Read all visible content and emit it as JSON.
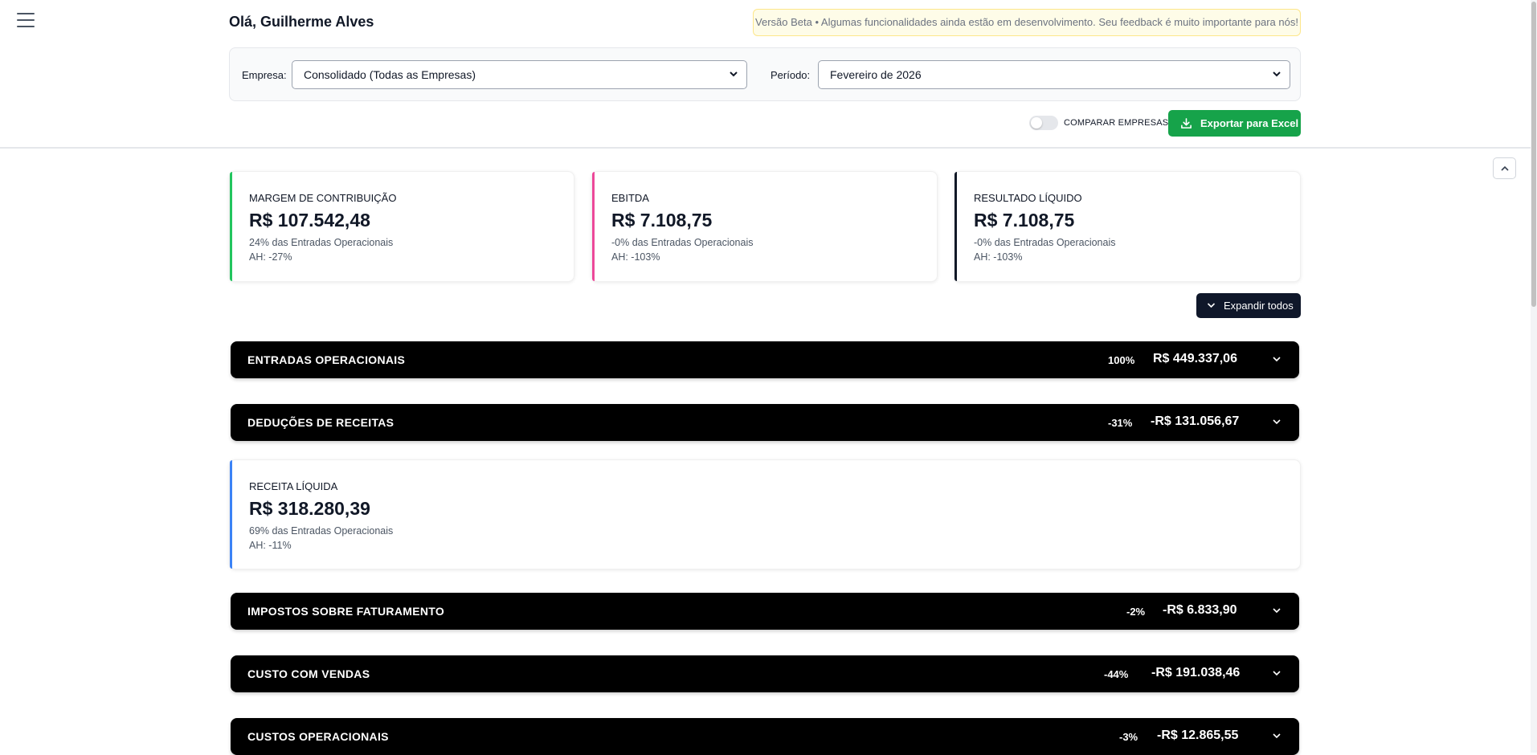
{
  "header": {
    "greeting": "Olá, Guilherme Alves",
    "beta_notice": "Versão Beta • Algumas funcionalidades ainda estão em desenvolvimento. Seu feedback é muito importante para nós!"
  },
  "filters": {
    "company_label": "Empresa:",
    "company_value": "Consolidado (Todas as Empresas)",
    "period_label": "Período:",
    "period_value": "Fevereiro de 2026"
  },
  "actions": {
    "compare_label": "COMPARAR EMPRESAS",
    "compare_enabled": false,
    "export_label": "Exportar para Excel",
    "expand_all_label": "Expandir todos"
  },
  "kpis": [
    {
      "title": "MARGEM DE CONTRIBUIÇÃO",
      "value": "R$ 107.542,48",
      "sub": "24% das Entradas Operacionais",
      "ah": "AH: -27%",
      "color": "#22c55e"
    },
    {
      "title": "EBITDA",
      "value": "R$ 7.108,75",
      "sub": "-0% das Entradas Operacionais",
      "ah": "AH: -103%",
      "color": "#ec4899"
    },
    {
      "title": "RESULTADO LÍQUIDO",
      "value": "R$ 7.108,75",
      "sub": "-0% das Entradas Operacionais",
      "ah": "AH: -103%",
      "color": "#111827"
    }
  ],
  "sections": [
    {
      "title": "ENTRADAS OPERACIONAIS",
      "pct": "100%",
      "value": "R$ 449.337,06"
    },
    {
      "title": "DEDUÇÕES DE RECEITAS",
      "pct": "-31%",
      "value": "-R$ 131.056,67"
    },
    {
      "title": "IMPOSTOS SOBRE FATURAMENTO",
      "pct": "-2%",
      "value": "-R$ 6.833,90"
    },
    {
      "title": "CUSTO COM VENDAS",
      "pct": "-44%",
      "value": "-R$ 191.038,46"
    },
    {
      "title": "CUSTOS OPERACIONAIS",
      "pct": "-3%",
      "value": "-R$ 12.865,55"
    }
  ],
  "net_revenue": {
    "title": "RECEITA LÍQUIDA",
    "value": "R$ 318.280,39",
    "sub": "69% das Entradas Operacionais",
    "ah": "AH: -11%",
    "color": "#3b82f6"
  },
  "colors": {
    "export_green": "#16a34a",
    "dark_button": "#0f172a",
    "section_bg": "#000000"
  }
}
